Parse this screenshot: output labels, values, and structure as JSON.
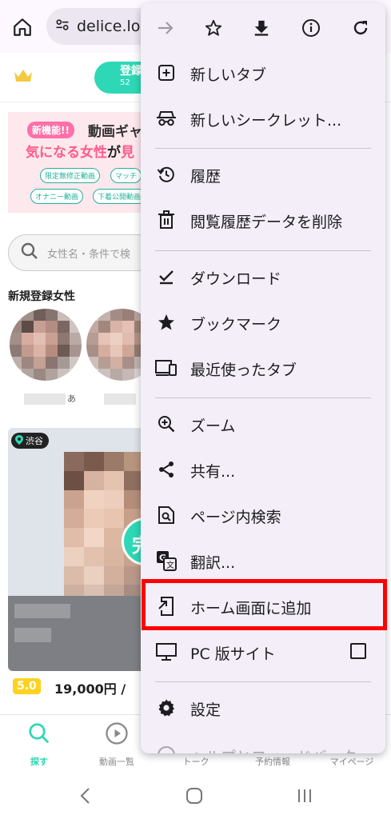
{
  "browser": {
    "url": "delice.lov",
    "home_icon": "home-icon",
    "site_info_icon": "tune-icon"
  },
  "site": {
    "register_label": "登録",
    "register_sub": "52",
    "banner": {
      "new_badge": "新機能!!",
      "headline": "動画ギャ",
      "sub_pre": "気になる女性",
      "sub_mid": "が",
      "sub_post": "見",
      "tags": [
        "限定無修正動画",
        "マッチ",
        "オナニー動画",
        "下着公開動画"
      ]
    },
    "search_placeholder": "女性名・条件で検",
    "new_section_title": "新規登録女性",
    "avatar_caption": "あ",
    "card": {
      "location": "渋谷",
      "side_badge": "完",
      "rating": "5.0",
      "price": "19,000円",
      "price_suffix": "/"
    },
    "nav": [
      {
        "label": "探す"
      },
      {
        "label": "動画一覧"
      },
      {
        "label": "トーク"
      },
      {
        "label": "予約情報"
      },
      {
        "label": "マイページ"
      }
    ]
  },
  "menu": {
    "items": [
      {
        "label": "新しいタブ",
        "icon": "new-tab-icon"
      },
      {
        "label": "新しいシークレット...",
        "icon": "incognito-icon"
      },
      {
        "label": "履歴",
        "icon": "history-icon"
      },
      {
        "label": "閲覧履歴データを削除",
        "icon": "trash-icon"
      },
      {
        "label": "ダウンロード",
        "icon": "download-done-icon"
      },
      {
        "label": "ブックマーク",
        "icon": "star-icon"
      },
      {
        "label": "最近使ったタブ",
        "icon": "devices-icon"
      },
      {
        "label": "ズーム",
        "icon": "zoom-in-icon"
      },
      {
        "label": "共有...",
        "icon": "share-icon"
      },
      {
        "label": "ページ内検索",
        "icon": "find-in-page-icon"
      },
      {
        "label": "翻訳...",
        "icon": "translate-icon"
      },
      {
        "label": "ホーム画面に追加",
        "icon": "add-to-home-icon"
      },
      {
        "label": "PC 版サイト",
        "icon": "desktop-icon"
      },
      {
        "label": "設定",
        "icon": "settings-icon"
      },
      {
        "label": "ヘルプとフィードバック",
        "icon": "help-icon"
      }
    ],
    "desktop_site_checked": false
  },
  "colors": {
    "highlight": "#ff0000",
    "accent": "#2ed8b6",
    "menu_bg": "#f3eef7"
  }
}
